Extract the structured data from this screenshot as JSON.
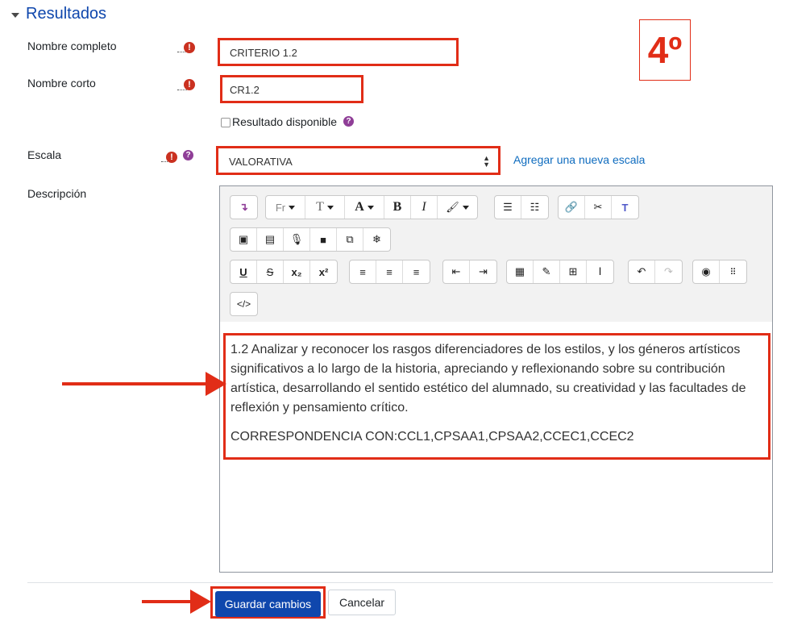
{
  "section": {
    "title": "Resultados"
  },
  "form": {
    "fullname": {
      "label": "Nombre completo",
      "value": "CRITERIO 1.2"
    },
    "shortname": {
      "label": "Nombre corto",
      "value": "CR1.2"
    },
    "available": {
      "label": "Resultado disponible",
      "checked": false
    },
    "scale": {
      "label": "Escala",
      "value": "VALORATIVA",
      "add_link": "Agregar una nueva escala"
    },
    "description": {
      "label": "Descripción",
      "paragraph1": "1.2 Analizar y reconocer los rasgos diferenciadores de los estilos, y los géneros artísticos significativos a lo largo de la historia, apreciando y reflexionando sobre su contribución artística, desarrollando el sentido estético del alumnado, su creatividad y las facultades de reflexión y pensamiento crítico.",
      "paragraph2": "CORRESPONDENCIA CON:CCL1,CPSAA1,CPSAA2,CCEC1,CCEC2"
    }
  },
  "annotation": {
    "step": "4º"
  },
  "buttons": {
    "save": "Guardar cambios",
    "cancel": "Cancelar"
  },
  "toolbar": {
    "font_family": "Fr",
    "bold": "B",
    "italic": "I",
    "underline": "U",
    "strike": "S",
    "subscript": "x₂",
    "superscript": "x²"
  },
  "colors": {
    "accent": "#0f47ad",
    "highlight": "#e12d17",
    "required": "#ca3120",
    "help": "#8f3e97"
  }
}
